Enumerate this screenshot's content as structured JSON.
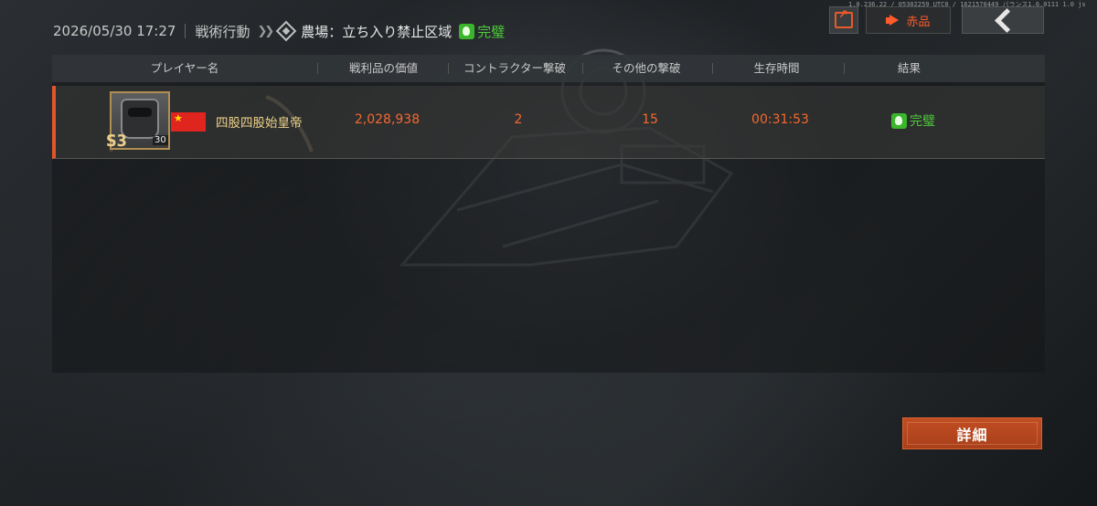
{
  "header": {
    "datetime": "2026/05/30 17:27",
    "mode": "戦術行動",
    "map": "農場：立ち入り禁止区域",
    "status": "完璧",
    "tech_info": "1.0.236.22 / 05302259 UTC0 / 1621570449 バランス1.6.0111 1.0 js"
  },
  "toolbar": {
    "share_icon": "share-icon",
    "red_button_label": "赤品",
    "back_icon": "back-icon"
  },
  "table": {
    "columns": [
      "プレイヤー名",
      "戦利品の価値",
      "コントラクター撃破",
      "その他の撃破",
      "生存時間",
      "結果"
    ],
    "rows": [
      {
        "season": "S3",
        "level": "30",
        "flag": "china-flag",
        "name": "四股四股始皇帝",
        "loot_value": "2,028,938",
        "contractor_kills": "2",
        "other_kills": "15",
        "survival_time": "00:31:53",
        "result": "完璧"
      }
    ]
  },
  "footer": {
    "detail_label": "詳細"
  },
  "colors": {
    "accent": "#e1562a",
    "stat": "#f3692f",
    "success": "#4ccb3a",
    "name": "#f0d48a"
  }
}
